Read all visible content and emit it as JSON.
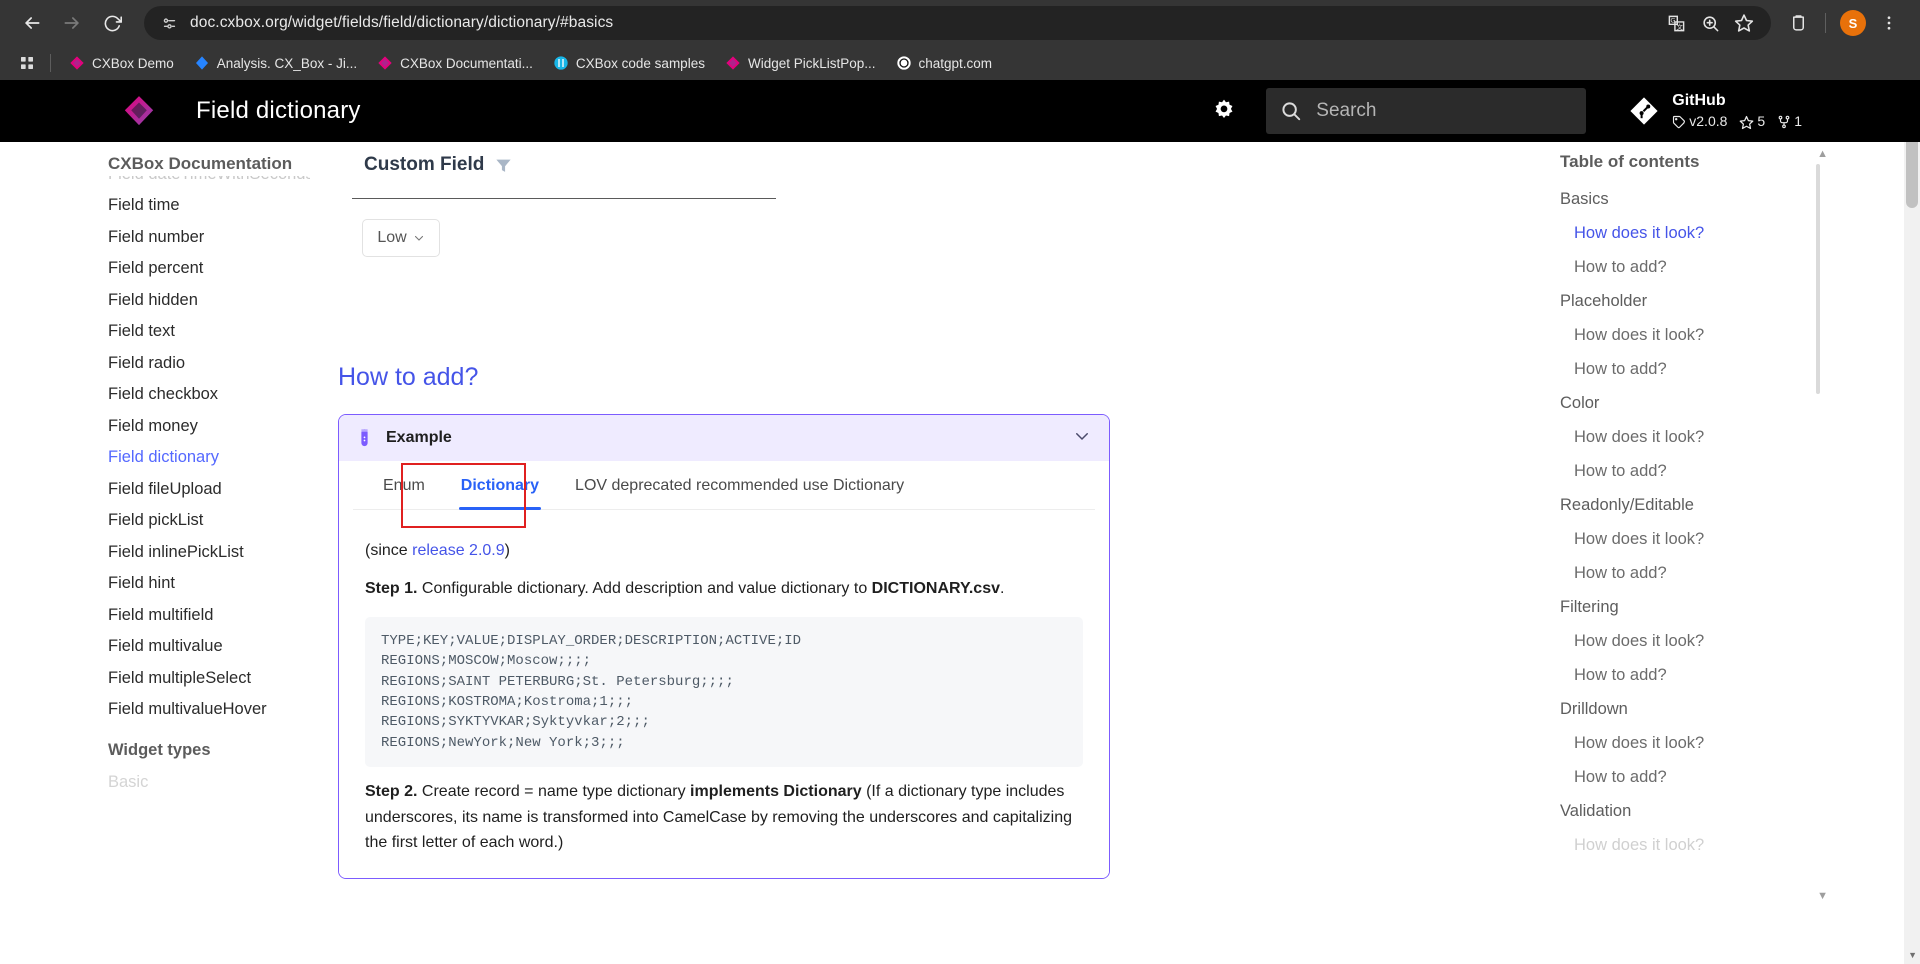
{
  "browser": {
    "nav": {
      "back": "back-arrow",
      "forward": "forward-arrow",
      "reload": "reload"
    },
    "omnibox": {
      "url": "doc.cxbox.org/widget/fields/field/dictionary/dictionary/#basics",
      "site_info_icon": "page-info-icon",
      "actions": [
        "translate-icon",
        "zoom-icon",
        "bookmark-star-icon"
      ]
    },
    "toolbar_right": {
      "extensions_icon": "extensions-icon",
      "profile_initial": "S",
      "menu_icon": "kebab-menu-icon"
    },
    "bookmarks": [
      {
        "label": "CXBox Demo",
        "favicon": "cxbox-logo"
      },
      {
        "label": "Analysis. CX_Box - Ji...",
        "favicon": "jira-logo"
      },
      {
        "label": "CXBox Documentati...",
        "favicon": "cxbox-logo"
      },
      {
        "label": "CXBox code samples",
        "favicon": "github-logo"
      },
      {
        "label": "Widget PickListPop...",
        "favicon": "cxbox-logo"
      },
      {
        "label": "chatgpt.com",
        "favicon": "openai-logo"
      }
    ]
  },
  "site_header": {
    "logo": "cxbox-logo",
    "title": "Field dictionary",
    "settings_icon": "gear-icon",
    "search": {
      "placeholder": "Search",
      "icon": "search-icon"
    },
    "github": {
      "icon": "git-icon",
      "name": "GitHub",
      "version": "v2.0.8",
      "stars": "5",
      "forks": "1",
      "tag_icon": "tag-icon",
      "star_icon": "star-icon",
      "fork_icon": "fork-icon"
    }
  },
  "sidebar": {
    "sticky_title": "CXBox Documentation",
    "faded_item": "Field dateTimeWithSeconds",
    "items": [
      "Field time",
      "Field number",
      "Field percent",
      "Field hidden",
      "Field text",
      "Field radio",
      "Field checkbox",
      "Field money",
      "Field dictionary",
      "Field fileUpload",
      "Field pickList",
      "Field inlinePickList",
      "Field hint",
      "Field multifield",
      "Field multivalue",
      "Field multipleSelect",
      "Field multivalueHover"
    ],
    "active_item": "Field dictionary",
    "group_label": "Widget types",
    "cut_item": "Basic"
  },
  "main": {
    "demo": {
      "title": "Custom Field",
      "filter_icon": "filter-icon",
      "select_value": "Low",
      "select_chevron": "chevron-down-icon"
    },
    "heading": "How to add?",
    "admonition": {
      "icon": "test-tube-icon",
      "title": "Example",
      "collapse_icon": "chevron-down-icon"
    },
    "tabs": [
      {
        "label": "Enum",
        "active": false
      },
      {
        "label": "Dictionary",
        "active": true
      },
      {
        "label": "LOV deprecated recommended use Dictionary",
        "active": false
      }
    ],
    "since": {
      "prefix": "(since ",
      "link": "release 2.0.9",
      "suffix": ")"
    },
    "step1": {
      "label": "Step 1.",
      "text": " Configurable dictionary. Add description and value dictionary to ",
      "bold_tail": "DICTIONARY.csv",
      "tail": "."
    },
    "code": "TYPE;KEY;VALUE;DISPLAY_ORDER;DESCRIPTION;ACTIVE;ID\nREGIONS;MOSCOW;Moscow;;;;\nREGIONS;SAINT PETERBURG;St. Petersburg;;;;\nREGIONS;KOSTROMA;Kostroma;1;;;\nREGIONS;SYKTYVKAR;Syktyvkar;2;;;\nREGIONS;NewYork;New York;3;;;",
    "step2": {
      "label": "Step 2.",
      "text": " Create record = name type dictionary ",
      "bold_mid": "implements Dictionary",
      "tail": " (If a dictionary type includes underscores, its name is transformed into CamelCase by removing the underscores and capitalizing the first letter of each word.)"
    }
  },
  "toc": {
    "title": "Table of contents",
    "items": [
      {
        "label": "Basics",
        "level": 1,
        "active": false
      },
      {
        "label": "How does it look?",
        "level": 2,
        "active": true
      },
      {
        "label": "How to add?",
        "level": 2,
        "active": false
      },
      {
        "label": "Placeholder",
        "level": 1,
        "active": false
      },
      {
        "label": "How does it look?",
        "level": 2,
        "active": false
      },
      {
        "label": "How to add?",
        "level": 2,
        "active": false
      },
      {
        "label": "Color",
        "level": 1,
        "active": false
      },
      {
        "label": "How does it look?",
        "level": 2,
        "active": false
      },
      {
        "label": "How to add?",
        "level": 2,
        "active": false
      },
      {
        "label": "Readonly/Editable",
        "level": 1,
        "active": false
      },
      {
        "label": "How does it look?",
        "level": 2,
        "active": false
      },
      {
        "label": "How to add?",
        "level": 2,
        "active": false
      },
      {
        "label": "Filtering",
        "level": 1,
        "active": false
      },
      {
        "label": "How does it look?",
        "level": 2,
        "active": false
      },
      {
        "label": "How to add?",
        "level": 2,
        "active": false
      },
      {
        "label": "Drilldown",
        "level": 1,
        "active": false
      },
      {
        "label": "How does it look?",
        "level": 2,
        "active": false
      },
      {
        "label": "How to add?",
        "level": 2,
        "active": false
      },
      {
        "label": "Validation",
        "level": 1,
        "active": false
      }
    ],
    "cut_item": "How does it look?"
  },
  "colors": {
    "accent_blue": "#4554e8",
    "tab_blue": "#2962f7",
    "admonition_purple": "#7c5cff",
    "highlight_red": "#e02020",
    "header_black": "#000000"
  }
}
